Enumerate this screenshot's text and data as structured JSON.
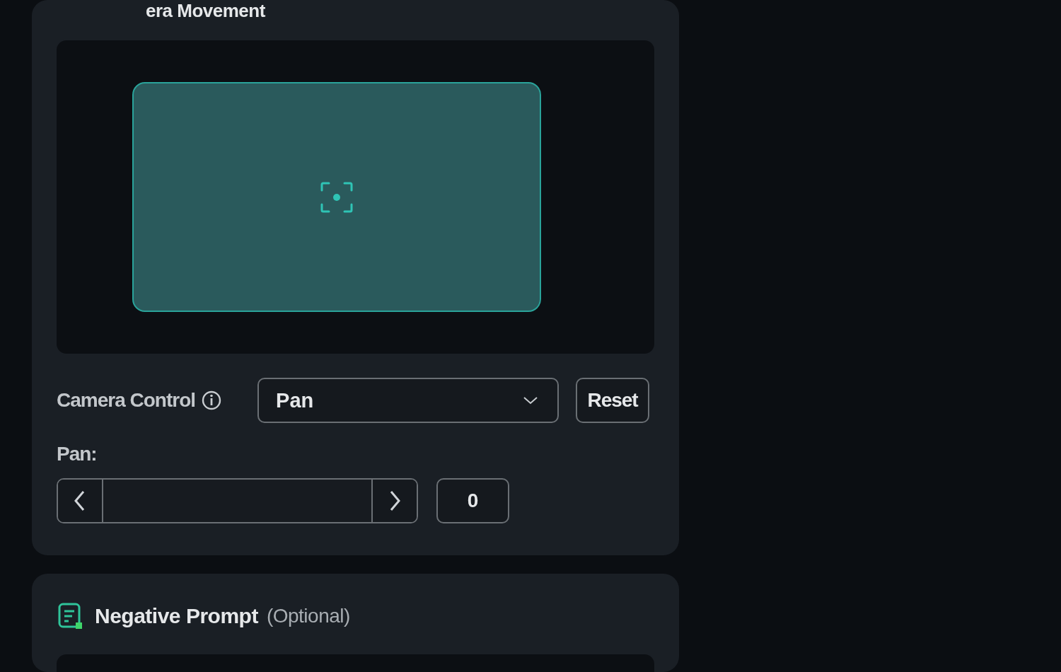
{
  "camera_movement": {
    "title": "era Movement",
    "camera_control": {
      "label": "Camera Control",
      "value": "Pan",
      "reset": "Reset"
    },
    "slider": {
      "label": "Pan:",
      "value": "0"
    }
  },
  "negative_prompt": {
    "title": "Negative Prompt",
    "note": "(Optional)"
  }
}
